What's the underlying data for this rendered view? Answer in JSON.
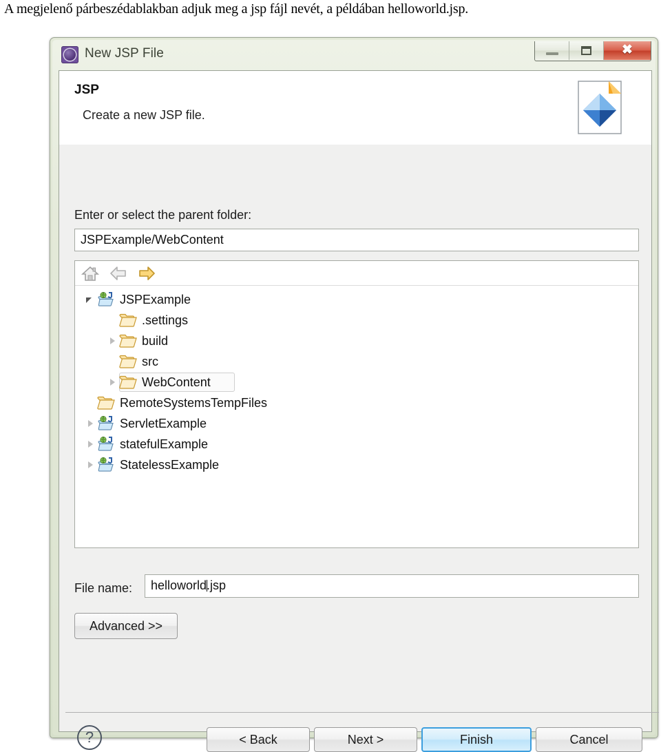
{
  "caption": {
    "text": "A megjelenő párbeszédablakban adjuk meg a jsp fájl nevét, a példában helloworld.jsp."
  },
  "dialog": {
    "title": "New JSP File",
    "title_icon": "eclipse-wizard-icon",
    "window_controls": {
      "minimize": "minimize-icon",
      "maximize": "maximize-icon",
      "close": "✖"
    },
    "header": {
      "title": "JSP",
      "subtitle": "Create a new JSP file.",
      "banner_icon": "jsp-file-banner-icon"
    },
    "parent_folder": {
      "label": "Enter or select the parent folder:",
      "value": "JSPExample/WebContent",
      "placeholder": ""
    },
    "tree": {
      "toolbar": [
        {
          "name": "home-icon",
          "enabled": false
        },
        {
          "name": "back-arrow-icon",
          "enabled": false
        },
        {
          "name": "forward-arrow-icon",
          "enabled": true
        }
      ],
      "items": [
        {
          "label": "JSPExample",
          "icon": "web-project-icon",
          "indent": 0,
          "twisty": "expanded",
          "selected": false
        },
        {
          "label": ".settings",
          "icon": "folder-icon",
          "indent": 1,
          "twisty": "none",
          "selected": false
        },
        {
          "label": "build",
          "icon": "folder-icon",
          "indent": 1,
          "twisty": "collapsed",
          "selected": false
        },
        {
          "label": "src",
          "icon": "folder-icon",
          "indent": 1,
          "twisty": "none",
          "selected": false
        },
        {
          "label": "WebContent",
          "icon": "folder-icon",
          "indent": 1,
          "twisty": "collapsed",
          "selected": true
        },
        {
          "label": "RemoteSystemsTempFiles",
          "icon": "folder-icon",
          "indent": 0,
          "twisty": "none",
          "selected": false
        },
        {
          "label": "ServletExample",
          "icon": "web-project-icon",
          "indent": 0,
          "twisty": "collapsed",
          "selected": false
        },
        {
          "label": "statefulExample",
          "icon": "web-project-icon",
          "indent": 0,
          "twisty": "collapsed",
          "selected": false
        },
        {
          "label": "StatelessExample",
          "icon": "web-project-icon",
          "indent": 0,
          "twisty": "collapsed",
          "selected": false
        }
      ]
    },
    "file_name": {
      "label": "File name:",
      "value_before_caret": "helloworld",
      "value_after_caret": ".jsp",
      "full_value": "helloworld.jsp"
    },
    "advanced_button": "Advanced >>",
    "footer": {
      "help_icon": "?",
      "buttons": [
        {
          "label": "< Back",
          "name": "back-button",
          "default": false
        },
        {
          "label": "Next >",
          "name": "next-button",
          "default": false
        },
        {
          "label": "Finish",
          "name": "finish-button",
          "default": true
        },
        {
          "label": "Cancel",
          "name": "cancel-button",
          "default": false
        }
      ]
    }
  },
  "colors": {
    "titlebar_green": "#e3e9d8",
    "close_red": "#c43f2a",
    "default_button_blue": "#3c9ede",
    "panel_gray": "#f0f0ef",
    "folder_yellow": "#f6c96a",
    "project_icon_blue": "#6fa8d8"
  }
}
